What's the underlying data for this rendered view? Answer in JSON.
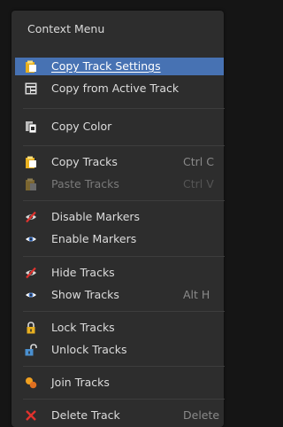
{
  "menu": {
    "title": "Context Menu",
    "items": [
      {
        "label": "Copy Track Settings",
        "shortcut": "",
        "icon": "clipboard-copy-icon",
        "state": "highlighted"
      },
      {
        "label": "Copy from Active Track",
        "shortcut": "",
        "icon": "copy-from-active-icon",
        "state": "normal"
      },
      {
        "label": "Copy Color",
        "shortcut": "",
        "icon": "copy-color-icon",
        "state": "normal"
      },
      {
        "label": "Copy Tracks",
        "shortcut": "Ctrl C",
        "icon": "clipboard-copy-icon",
        "state": "normal"
      },
      {
        "label": "Paste Tracks",
        "shortcut": "Ctrl V",
        "icon": "clipboard-paste-icon",
        "state": "disabled"
      },
      {
        "label": "Disable Markers",
        "shortcut": "",
        "icon": "eye-disabled-icon",
        "state": "normal"
      },
      {
        "label": "Enable Markers",
        "shortcut": "",
        "icon": "eye-icon",
        "state": "normal"
      },
      {
        "label": "Hide Tracks",
        "shortcut": "",
        "icon": "eye-hidden-icon",
        "state": "normal"
      },
      {
        "label": "Show Tracks",
        "shortcut": "Alt H",
        "icon": "eye-icon",
        "state": "normal"
      },
      {
        "label": "Lock Tracks",
        "shortcut": "",
        "icon": "lock-closed-icon",
        "state": "normal"
      },
      {
        "label": "Unlock Tracks",
        "shortcut": "",
        "icon": "lock-open-icon",
        "state": "normal"
      },
      {
        "label": "Join Tracks",
        "shortcut": "",
        "icon": "join-tracks-icon",
        "state": "normal"
      },
      {
        "label": "Delete Track",
        "shortcut": "Delete",
        "icon": "delete-x-icon",
        "state": "normal"
      }
    ]
  },
  "colors": {
    "menu_background": "#2d2d2d",
    "highlight": "#4772b3",
    "text": "#dcdcdc",
    "shortcut_text": "#8a8a8a",
    "disabled_text": "#7a7a7a",
    "delete_icon": "#e0322e",
    "clipboard_icon": "#f0c040"
  }
}
